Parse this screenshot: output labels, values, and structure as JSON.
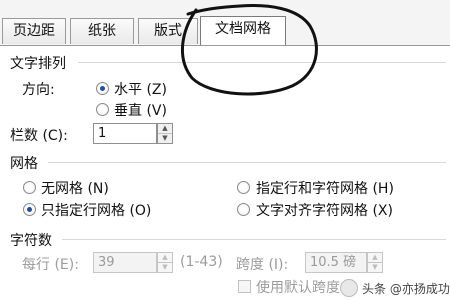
{
  "tabs": [
    {
      "label": "页边距"
    },
    {
      "label": "纸张"
    },
    {
      "label": "版式"
    },
    {
      "label": "文档网格"
    }
  ],
  "text_direction": {
    "heading": "文字排列",
    "direction_label": "方向:",
    "horizontal_label": "水平 (Z)",
    "vertical_label": "垂直 (V)",
    "selected": "horizontal",
    "columns_label": "栏数 (C):",
    "columns_value": "1"
  },
  "grid": {
    "heading": "网格",
    "options": [
      {
        "label": "无网格 (N)",
        "checked": false
      },
      {
        "label": "只指定行网格 (O)",
        "checked": true
      },
      {
        "label": "指定行和字符网格 (H)",
        "checked": false
      },
      {
        "label": "文字对齐字符网格 (X)",
        "checked": false
      }
    ]
  },
  "characters": {
    "heading": "字符数",
    "per_line_label": "每行 (E):",
    "per_line_value": "39",
    "range": "(1-43)",
    "pitch_label": "跨度 (I):",
    "pitch_value": "10.5 磅",
    "default_pitch_label": "使用默认跨度 ("
  },
  "watermark": {
    "text": "头条 @亦扬成功"
  }
}
